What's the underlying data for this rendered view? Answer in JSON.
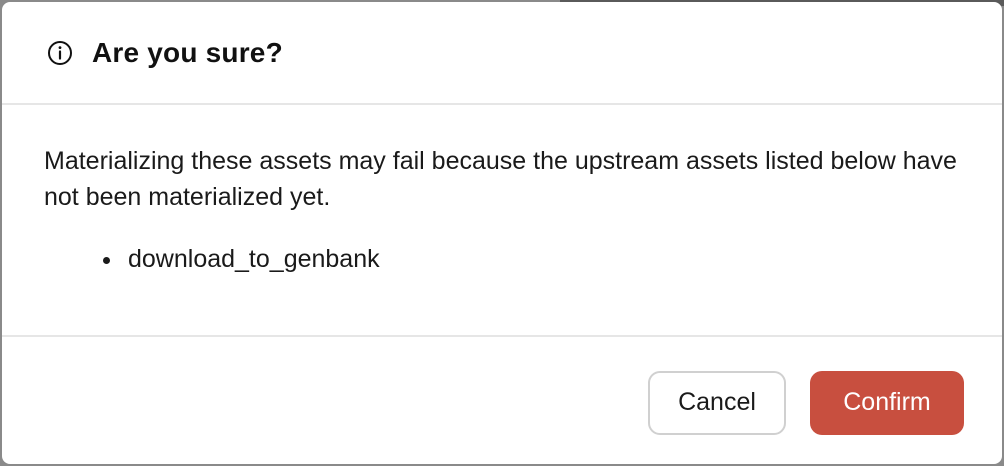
{
  "dialog": {
    "title": "Are you sure?",
    "title_icon": "info-icon",
    "message": "Materializing these assets may fail because the upstream assets listed below have not been materialized yet.",
    "assets": [
      "download_to_genbank"
    ],
    "cancel_label": "Cancel",
    "confirm_label": "Confirm",
    "confirm_color": "#c84f3f"
  }
}
